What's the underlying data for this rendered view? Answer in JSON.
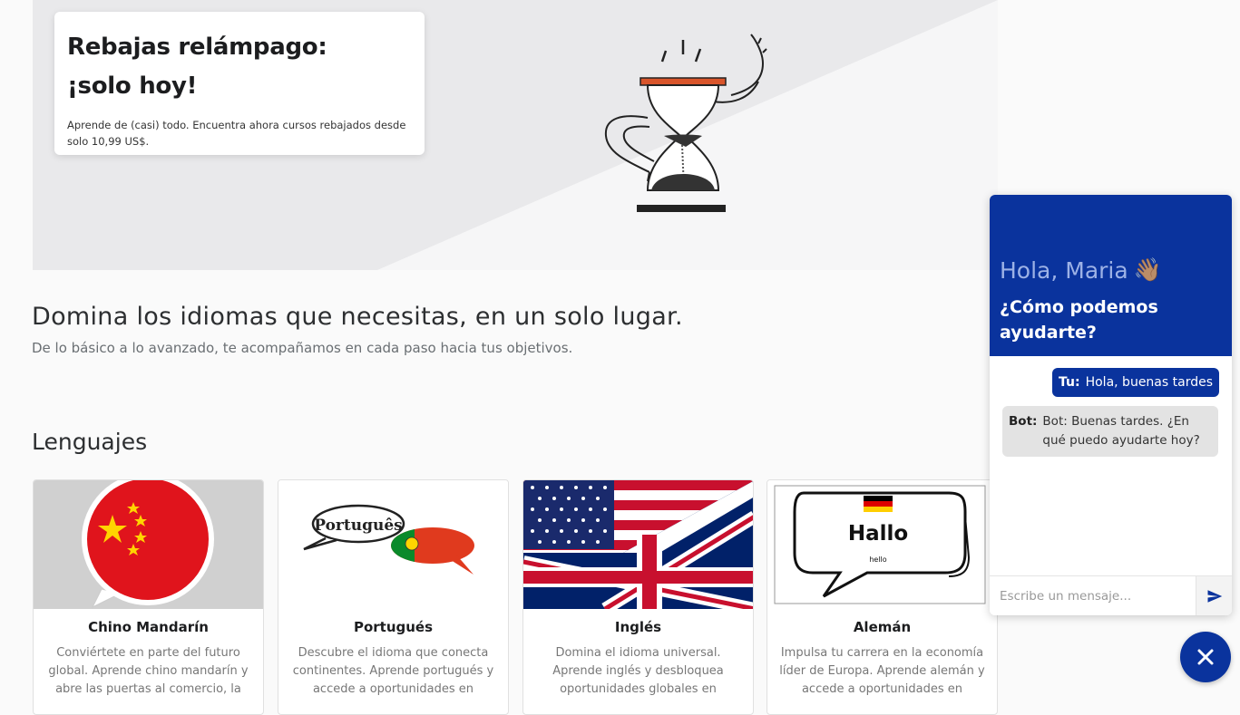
{
  "promo": {
    "title_line1": "Rebajas relámpago:",
    "title_line2": "¡solo hoy!",
    "description": "Aprende de (casi) todo. Encuentra ahora cursos rebajados desde solo 10,99 US$."
  },
  "headline": {
    "title": "Domina los idiomas que necesitas, en un solo lugar.",
    "subtitle": "De lo básico a lo avanzado, te acompañamos en cada paso hacia tus objetivos."
  },
  "languages": {
    "title": "Lenguajes",
    "cards": [
      {
        "name": "Chino Mandarín",
        "desc": "Conviértete en parte del futuro global. Aprende chino mandarín y abre las puertas al comercio, la",
        "icon": "china-flag-bubble"
      },
      {
        "name": "Portugués",
        "desc": "Descubre el idioma que conecta continentes. Aprende portugués y accede a oportunidades en",
        "icon": "portugal-speech-bubbles",
        "bubble_text": "Português"
      },
      {
        "name": "Inglés",
        "desc": "Domina el idioma universal. Aprende inglés y desbloquea oportunidades globales en",
        "icon": "us-uk-flags"
      },
      {
        "name": "Alemán",
        "desc": "Impulsa tu carrera en la economía líder de Europa. Aprende alemán y accede a oportunidades en",
        "icon": "german-hallo-bubble",
        "bubble_text": "Hallo",
        "bubble_small": "hello"
      }
    ]
  },
  "chat": {
    "greeting": "Hola, Maria",
    "greeting_emoji": "👋🏽",
    "question": "¿Cómo podemos ayudarte?",
    "messages": [
      {
        "sender": "Tu:",
        "text": "Hola, buenas tardes"
      },
      {
        "sender": "Bot:",
        "text": "Bot: Buenas tardes. ¿En qué puedo ayudarte hoy?"
      }
    ],
    "input_placeholder": "Escribe un mensaje...",
    "accent": "#0a339d"
  }
}
